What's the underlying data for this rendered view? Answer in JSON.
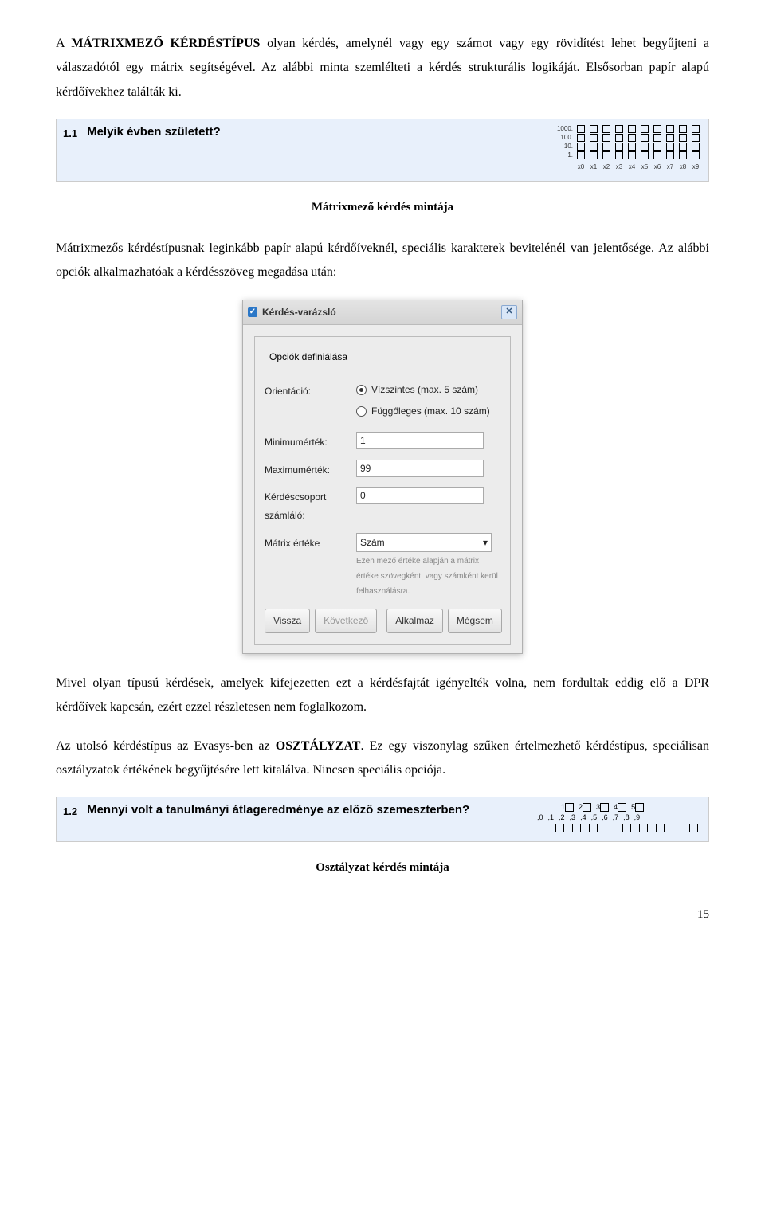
{
  "para1_pre": "A ",
  "para1_bold1": "MÁTRIXMEZŐ KÉRDÉSTÍPUS",
  "para1_post": " olyan kérdés, amelynél vagy egy számot vagy egy rövidítést lehet begyűjteni a válaszadótól egy mátrix segítségével. Az alábbi minta szemlélteti a kérdés strukturális logikáját. Elsősorban papír alapú kérdőívekhez találták ki.",
  "matrixBar": {
    "num": "1.1",
    "text": "Melyik évben született?",
    "rowLabels": [
      "1000.",
      "100.",
      "10.",
      "1."
    ],
    "colLabels": [
      "x0",
      "x1",
      "x2",
      "x3",
      "x4",
      "x5",
      "x6",
      "x7",
      "x8",
      "x9"
    ]
  },
  "caption1": "Mátrixmező kérdés mintája",
  "para2": "Mátrixmezős kérdéstípusnak leginkább papír alapú kérdőíveknél, speciális karakterek bevitelénél van jelentősége. Az alábbi opciók alkalmazhatóak a kérdésszöveg megadása után:",
  "dialog": {
    "title": "Kérdés-varázsló",
    "legend": "Opciók definiálása",
    "orientacio_label": "Orientáció:",
    "orient1": "Vízszintes (max. 5 szám)",
    "orient2": "Függőleges (max. 10 szám)",
    "min_label": "Minimumérték:",
    "min_val": "1",
    "max_label": "Maximumérték:",
    "max_val": "99",
    "group_label": "Kérdéscsoport számláló:",
    "group_val": "0",
    "matrix_label": "Mátrix értéke",
    "matrix_val": "Szám",
    "hint": "Ezen mező értéke alapján a mátrix értéke szövegként, vagy számként kerül felhasználásra.",
    "btn_back": "Vissza",
    "btn_next": "Következő",
    "btn_apply": "Alkalmaz",
    "btn_cancel": "Mégsem"
  },
  "para3": "Mivel olyan típusú kérdések, amelyek kifejezetten ezt a kérdésfajtát igényelték volna, nem fordultak eddig elő a DPR kérdőívek kapcsán, ezért ezzel részletesen nem foglalkozom.",
  "para4_pre": "Az utolsó kérdéstípus az Evasys-ben az ",
  "para4_bold": "OSZTÁLYZAT",
  "para4_post": ". Ez egy viszonylag szűken értelmezhető kérdéstípus, speciálisan osztályzatok értékének begyűjtésére lett kitalálva. Nincsen speciális opciója.",
  "gradeBar": {
    "num": "1.2",
    "text": "Mennyi volt a tanulmányi átlageredménye az előző szemeszterben?",
    "top": [
      "1",
      "2",
      "3",
      "4",
      "5"
    ],
    "bot": [
      ",0",
      ",1",
      ",2",
      ",3",
      ",4",
      ",5",
      ",6",
      ",7",
      ",8",
      ",9"
    ]
  },
  "caption2": "Osztályzat kérdés mintája",
  "pageNum": "15"
}
